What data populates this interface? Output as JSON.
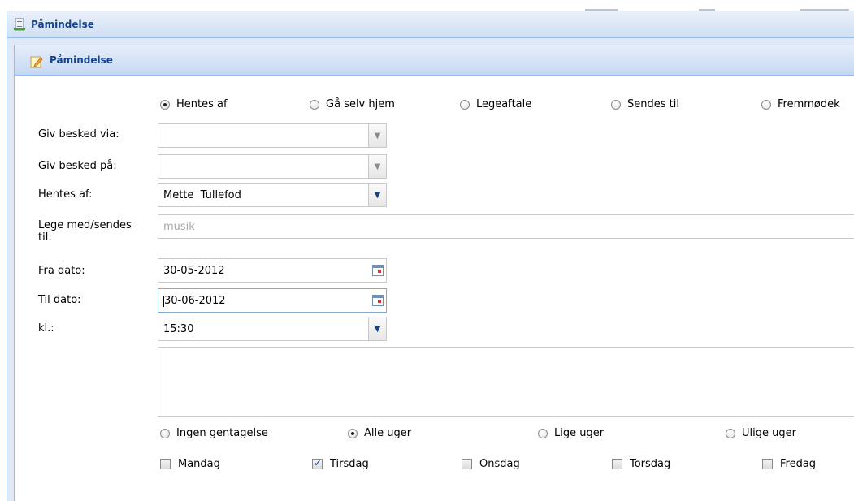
{
  "outer_panel": {
    "title": "Påmindelse"
  },
  "inner_panel": {
    "title": "Påmindelse"
  },
  "pickup_options": [
    {
      "label": "Hentes af",
      "selected": true
    },
    {
      "label": "Gå selv hjem",
      "selected": false
    },
    {
      "label": "Legeaftale",
      "selected": false
    },
    {
      "label": "Sendes til",
      "selected": false
    },
    {
      "label": "Fremmødek",
      "selected": false
    }
  ],
  "form": {
    "notify_via": {
      "label": "Giv besked via:",
      "value": ""
    },
    "notify_on": {
      "label": "Giv besked på:",
      "value": ""
    },
    "picked_up_by": {
      "label": "Hentes af:",
      "value": "Mette  Tullefod"
    },
    "play_with": {
      "label_line1": "Lege med/sendes",
      "label_line2": "til:",
      "placeholder": "musik"
    },
    "from_date": {
      "label": "Fra dato:",
      "value": "30-05-2012"
    },
    "to_date": {
      "label": "Til dato:",
      "value": "30-06-2012"
    },
    "time": {
      "label": "kl.:",
      "value": "15:30"
    },
    "note": {
      "value": ""
    }
  },
  "repeat_options": [
    {
      "label": "Ingen gentagelse",
      "selected": false
    },
    {
      "label": "Alle uger",
      "selected": true
    },
    {
      "label": "Lige uger",
      "selected": false
    },
    {
      "label": "Ulige uger",
      "selected": false
    }
  ],
  "weekdays": [
    {
      "label": "Mandag",
      "checked": false
    },
    {
      "label": "Tirsdag",
      "checked": true
    },
    {
      "label": "Onsdag",
      "checked": false
    },
    {
      "label": "Torsdag",
      "checked": false
    },
    {
      "label": "Fredag",
      "checked": false
    }
  ],
  "colors": {
    "panel_title": "#15428b",
    "panel_border": "#99bbe8"
  }
}
